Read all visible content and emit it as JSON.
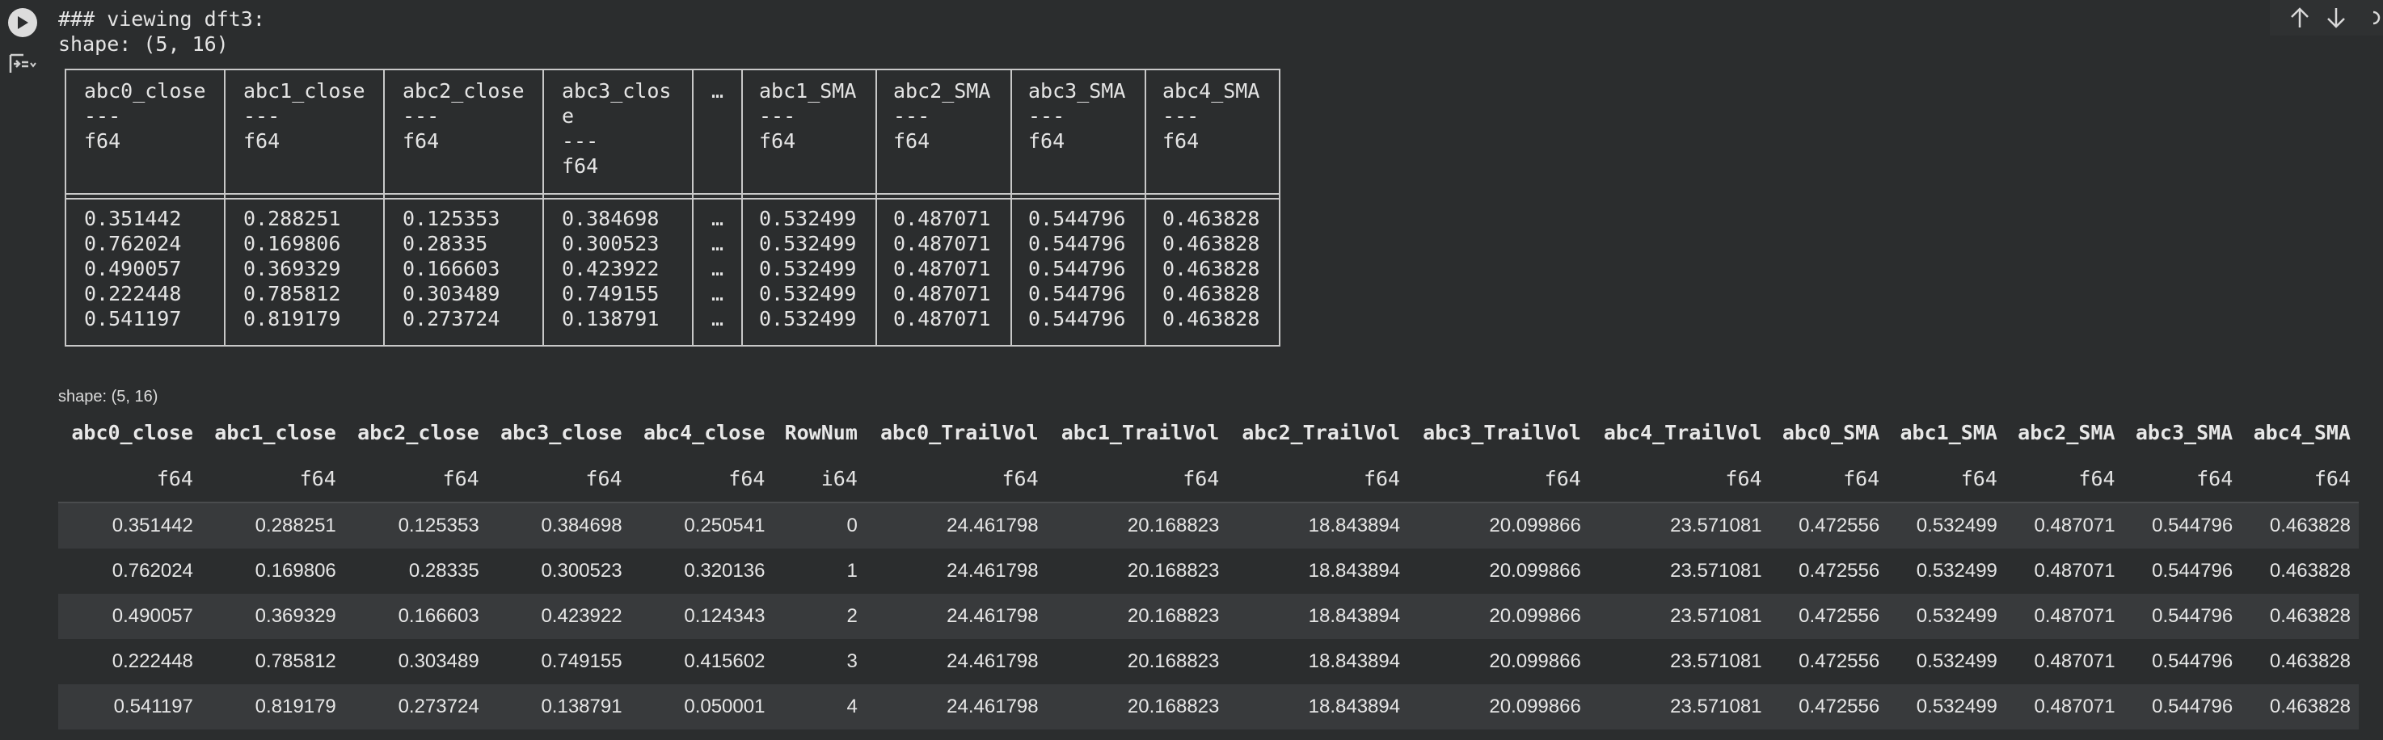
{
  "print_lines": [
    "### viewing dft3:",
    "shape: (5, 16)"
  ],
  "text_frame": {
    "columns": [
      {
        "header": "abc0_close\n---\nf64",
        "values": "0.351442\n0.762024\n0.490057\n0.222448\n0.541197"
      },
      {
        "header": "abc1_close\n---\nf64",
        "values": "0.288251\n0.169806\n0.369329\n0.785812\n0.819179"
      },
      {
        "header": "abc2_close\n---\nf64",
        "values": "0.125353\n0.28335\n0.166603\n0.303489\n0.273724"
      },
      {
        "header": "abc3_clos\ne\n---\nf64",
        "values": "0.384698\n0.300523\n0.423922\n0.749155\n0.138791"
      },
      {
        "header": "…",
        "values": "…\n…\n…\n…\n…"
      },
      {
        "header": "abc1_SMA\n---\nf64",
        "values": "0.532499\n0.532499\n0.532499\n0.532499\n0.532499"
      },
      {
        "header": "abc2_SMA\n---\nf64",
        "values": "0.487071\n0.487071\n0.487071\n0.487071\n0.487071"
      },
      {
        "header": "abc3_SMA\n---\nf64",
        "values": "0.544796\n0.544796\n0.544796\n0.544796\n0.544796"
      },
      {
        "header": "abc4_SMA\n---\nf64",
        "values": "0.463828\n0.463828\n0.463828\n0.463828\n0.463828"
      }
    ]
  },
  "html_frame": {
    "shape": "shape: (5, 16)",
    "columns": [
      "abc0_close",
      "abc1_close",
      "abc2_close",
      "abc3_close",
      "abc4_close",
      "RowNum",
      "abc0_TrailVol",
      "abc1_TrailVol",
      "abc2_TrailVol",
      "abc3_TrailVol",
      "abc4_TrailVol",
      "abc0_SMA",
      "abc1_SMA",
      "abc2_SMA",
      "abc3_SMA",
      "abc4_SMA"
    ],
    "dtypes": [
      "f64",
      "f64",
      "f64",
      "f64",
      "f64",
      "i64",
      "f64",
      "f64",
      "f64",
      "f64",
      "f64",
      "f64",
      "f64",
      "f64",
      "f64",
      "f64"
    ],
    "rows": [
      [
        "0.351442",
        "0.288251",
        "0.125353",
        "0.384698",
        "0.250541",
        "0",
        "24.461798",
        "20.168823",
        "18.843894",
        "20.099866",
        "23.571081",
        "0.472556",
        "0.532499",
        "0.487071",
        "0.544796",
        "0.463828"
      ],
      [
        "0.762024",
        "0.169806",
        "0.28335",
        "0.300523",
        "0.320136",
        "1",
        "24.461798",
        "20.168823",
        "18.843894",
        "20.099866",
        "23.571081",
        "0.472556",
        "0.532499",
        "0.487071",
        "0.544796",
        "0.463828"
      ],
      [
        "0.490057",
        "0.369329",
        "0.166603",
        "0.423922",
        "0.124343",
        "2",
        "24.461798",
        "20.168823",
        "18.843894",
        "20.099866",
        "23.571081",
        "0.472556",
        "0.532499",
        "0.487071",
        "0.544796",
        "0.463828"
      ],
      [
        "0.222448",
        "0.785812",
        "0.303489",
        "0.749155",
        "0.415602",
        "3",
        "24.461798",
        "20.168823",
        "18.843894",
        "20.099866",
        "23.571081",
        "0.472556",
        "0.532499",
        "0.487071",
        "0.544796",
        "0.463828"
      ],
      [
        "0.541197",
        "0.819179",
        "0.273724",
        "0.138791",
        "0.050001",
        "4",
        "24.461798",
        "20.168823",
        "18.843894",
        "20.099866",
        "23.571081",
        "0.472556",
        "0.532499",
        "0.487071",
        "0.544796",
        "0.463828"
      ]
    ]
  },
  "icons": {
    "run": "play-icon",
    "output": "output-settings-icon",
    "up": "arrow-up-icon",
    "down": "arrow-down-icon",
    "link": "link-icon"
  },
  "colors": {
    "background": "#2b2d2e",
    "stripe": "#383a3c",
    "border": "#c8c8c8"
  }
}
